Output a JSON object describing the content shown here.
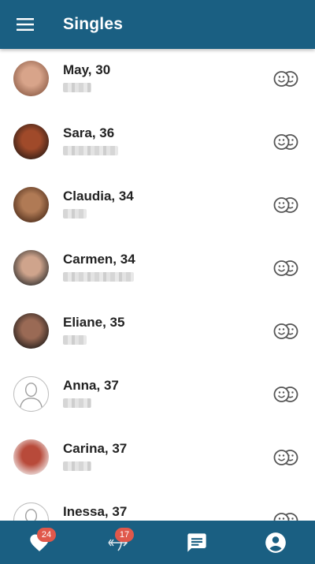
{
  "header": {
    "title": "Singles",
    "menu_icon": "hamburger-menu-icon"
  },
  "singles": [
    {
      "name": "May, 30",
      "avatar": "photo",
      "avatar_colors": [
        "#8a5a45",
        "#d8a48a"
      ]
    },
    {
      "name": "Sara, 36",
      "avatar": "photo",
      "avatar_colors": [
        "#2a1a14",
        "#a04a2a"
      ]
    },
    {
      "name": "Claudia, 34",
      "avatar": "photo",
      "avatar_colors": [
        "#4a2a18",
        "#b07a55"
      ]
    },
    {
      "name": "Carmen, 34",
      "avatar": "photo",
      "avatar_colors": [
        "#2a2a2a",
        "#cfa48c"
      ]
    },
    {
      "name": "Eliane, 35",
      "avatar": "photo",
      "avatar_colors": [
        "#1e1a18",
        "#9a6a55"
      ]
    },
    {
      "name": "Anna, 37",
      "avatar": "placeholder",
      "avatar_colors": [
        "#ffffff",
        "#9e9e9e"
      ]
    },
    {
      "name": "Carina, 37",
      "avatar": "photo",
      "avatar_colors": [
        "#f5f5f5",
        "#b84a3a"
      ]
    },
    {
      "name": "Inessa, 37",
      "avatar": "placeholder",
      "avatar_colors": [
        "#ffffff",
        "#9e9e9e"
      ]
    }
  ],
  "match_icon": "match-faces-icon",
  "bottom_nav": {
    "likes": {
      "icon": "heart-icon",
      "badge": "24"
    },
    "matches": {
      "icon": "cupid-arrow-icon",
      "badge": "17"
    },
    "messages": {
      "icon": "chat-icon"
    },
    "profile": {
      "icon": "account-icon"
    }
  },
  "colors": {
    "primary": "#1a5f82",
    "badge": "#e0584b",
    "icon_gray": "#555555"
  }
}
